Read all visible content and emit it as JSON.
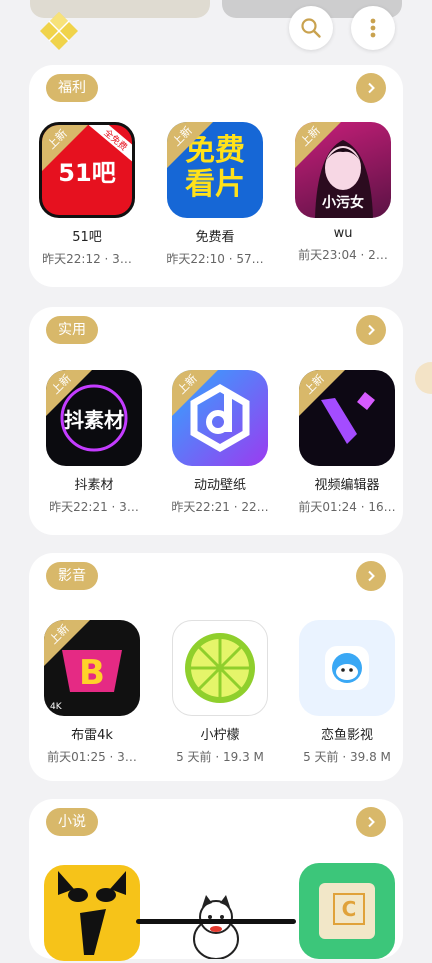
{
  "header": {
    "logo_icon": "yellow-diamond-logo-icon",
    "search_icon": "search-icon",
    "menu_icon": "vertical-dots-icon"
  },
  "ribbon_label": "上新",
  "sections": [
    {
      "tag": "福利",
      "apps": [
        {
          "name": "51吧",
          "meta": "昨天22:12 · 3…",
          "ribbon": true,
          "icon_text": "51吧",
          "icon_sub": "全免费"
        },
        {
          "name": "免费看",
          "meta": "昨天22:10 · 57…",
          "ribbon": true,
          "icon_text": "免费看片"
        },
        {
          "name": "wu",
          "meta": "前天23:04 · 2…",
          "ribbon": true,
          "icon_text": "小污女"
        }
      ]
    },
    {
      "tag": "实用",
      "apps": [
        {
          "name": "抖素材",
          "meta": "昨天22:21 · 3…",
          "ribbon": true,
          "icon_text": "抖素材"
        },
        {
          "name": "动动壁纸",
          "meta": "昨天22:21 · 22…",
          "ribbon": true,
          "icon_text": ""
        },
        {
          "name": "视频编辑器",
          "meta": "前天01:24 · 16…",
          "ribbon": true,
          "icon_text": ""
        }
      ]
    },
    {
      "tag": "影音",
      "apps": [
        {
          "name": "布雷4k",
          "meta": "前天01:25 · 3…",
          "ribbon": true,
          "icon_text": "4K"
        },
        {
          "name": "小柠檬",
          "meta": "5 天前 · 19.3 M",
          "ribbon": false,
          "icon_text": ""
        },
        {
          "name": "恋鱼影视",
          "meta": "5 天前 · 39.8 M",
          "ribbon": false,
          "icon_text": ""
        }
      ]
    },
    {
      "tag": "小说",
      "apps": [
        {
          "name": "",
          "meta": "",
          "ribbon": false,
          "icon_text": ""
        },
        {
          "name": "",
          "meta": "",
          "ribbon": false,
          "icon_text": ""
        },
        {
          "name": "",
          "meta": "",
          "ribbon": false,
          "icon_text": "C"
        }
      ]
    }
  ],
  "colors": {
    "accent": "#d8b86a",
    "card": "#ffffff",
    "bg": "#f2f2f4"
  }
}
